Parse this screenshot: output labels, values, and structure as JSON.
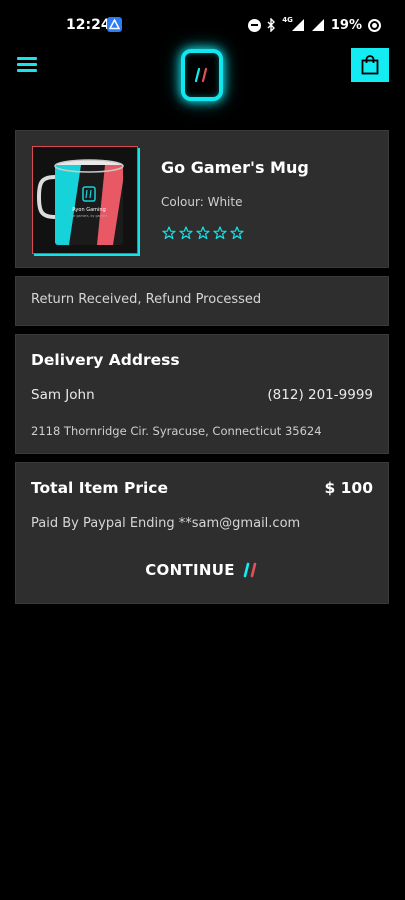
{
  "status_bar": {
    "time": "12:24",
    "network": "4G",
    "battery": "19%"
  },
  "header": {
    "menu_icon": "hamburger-menu-icon",
    "logo_icon": "brand-logo-icon",
    "cart_icon": "shopping-bag-icon",
    "accent_color": "#13ecf2"
  },
  "product": {
    "name": "Go Gamer's Mug",
    "colour": "Colour: White",
    "rating": 0,
    "max_rating": 5,
    "image_brand": "Ryon Gaming",
    "image_tagline": "For gamers, by gamers"
  },
  "order_status": {
    "text": "Return Received, Refund Processed"
  },
  "delivery": {
    "title": "Delivery Address",
    "name": "Sam John",
    "phone": "(812) 201-9999",
    "address": "2118 Thornridge Cir. Syracuse, Connecticut 35624"
  },
  "payment": {
    "title": "Total Item Price",
    "price": "$ 100",
    "paid_by": "Paid By Paypal Ending **sam@gmail.com",
    "continue_label": "CONTINUE"
  }
}
